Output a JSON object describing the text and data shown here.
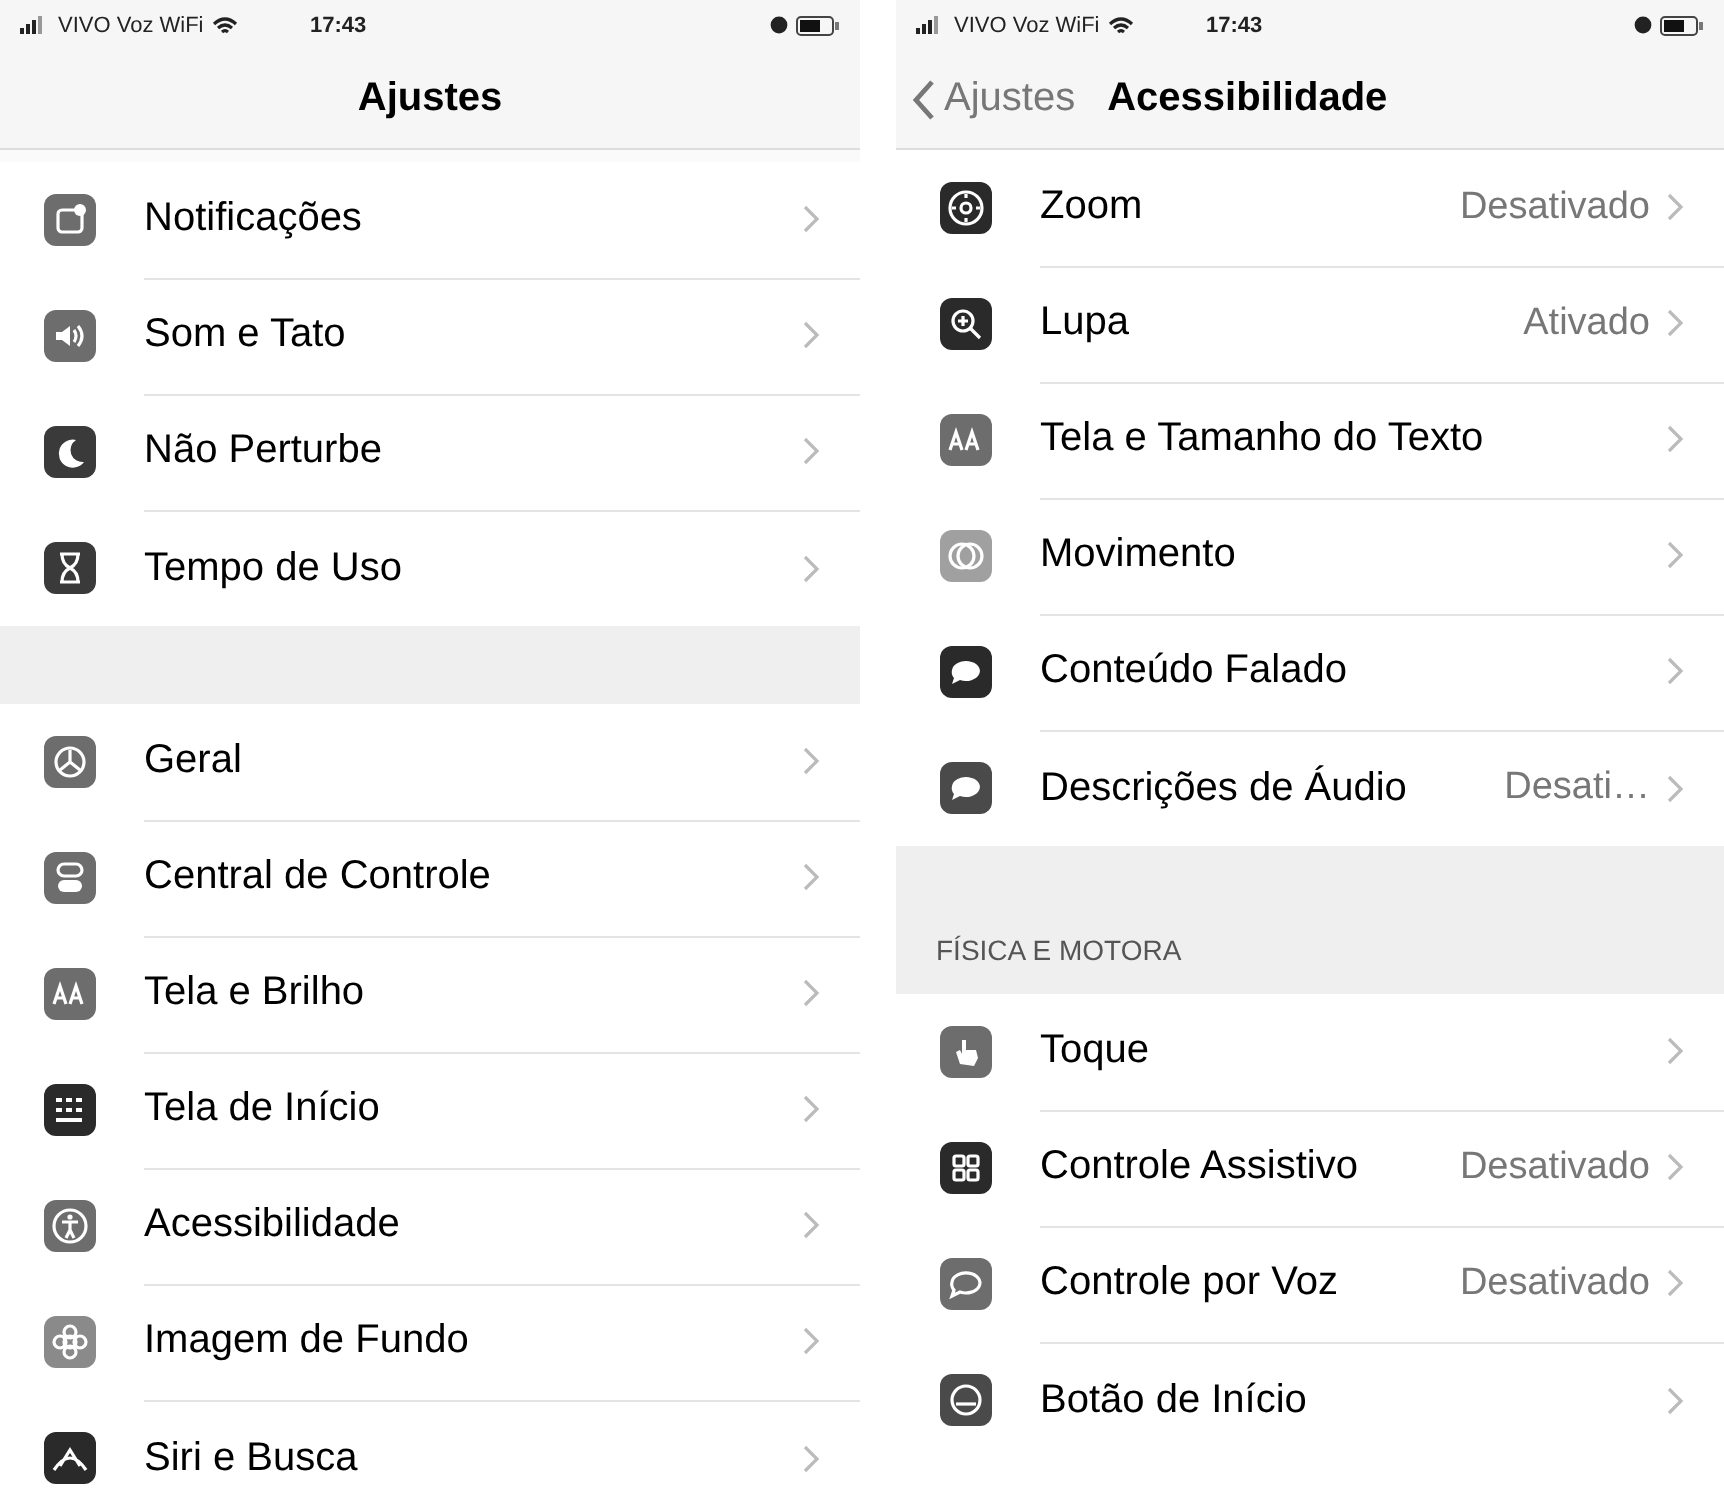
{
  "screens": [
    {
      "status_bar": {
        "carrier": "VIVO Voz WiFi",
        "time": "17:43"
      },
      "nav": {
        "title": "Ajustes"
      },
      "sections": [
        {
          "rows": [
            {
              "label": "Notificações"
            },
            {
              "label": "Som e Tato"
            },
            {
              "label": "Não Perturbe"
            },
            {
              "label": "Tempo de Uso"
            }
          ]
        },
        {
          "rows": [
            {
              "label": "Geral"
            },
            {
              "label": "Central de Controle"
            },
            {
              "label": "Tela e Brilho"
            },
            {
              "label": "Tela de Início"
            },
            {
              "label": "Acessibilidade"
            },
            {
              "label": "Imagem de Fundo"
            },
            {
              "label": "Siri e Busca"
            }
          ]
        }
      ]
    },
    {
      "status_bar": {
        "carrier": "VIVO Voz WiFi",
        "time": "17:43"
      },
      "nav": {
        "back": "Ajustes",
        "title": "Acessibilidade"
      },
      "sections": [
        {
          "rows": [
            {
              "label": "Zoom",
              "value": "Desativado"
            },
            {
              "label": "Lupa",
              "value": "Ativado"
            },
            {
              "label": "Tela e Tamanho do Texto"
            },
            {
              "label": "Movimento"
            },
            {
              "label": "Conteúdo Falado"
            },
            {
              "label": "Descrições de Áudio",
              "value": "Desati…"
            }
          ]
        },
        {
          "header": "FÍSICA E MOTORA",
          "rows": [
            {
              "label": "Toque"
            },
            {
              "label": "Controle Assistivo",
              "value": "Desativado"
            },
            {
              "label": "Controle por Voz",
              "value": "Desativado"
            },
            {
              "label": "Botão de Início"
            }
          ]
        }
      ]
    }
  ]
}
